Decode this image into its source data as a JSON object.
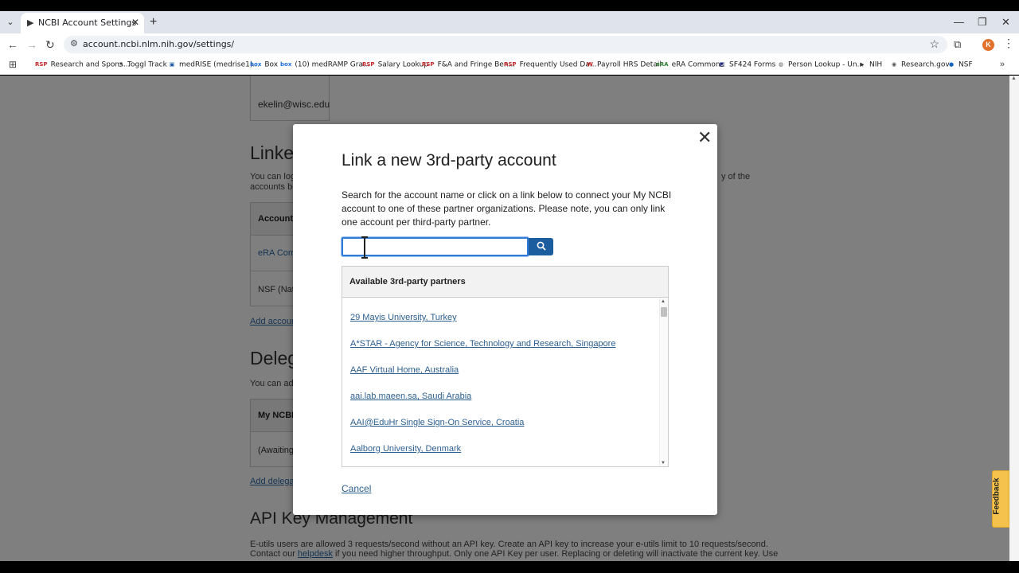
{
  "browser": {
    "tab_title": "NCBI Account Settings",
    "url": "account.ncbi.nlm.nih.gov/settings/",
    "avatar_letter": "K",
    "bookmarks": [
      {
        "label": "Research and Spons...",
        "icon": "RSP",
        "color": "#c62828"
      },
      {
        "label": "Toggl Track",
        "icon": "◔",
        "color": "#333"
      },
      {
        "label": "medRISE (medrise1)...",
        "icon": "▣",
        "color": "#1e5aa8"
      },
      {
        "label": "Box",
        "icon": "box",
        "color": "#1e6fd9"
      },
      {
        "label": "(10) medRAMP Gra...",
        "icon": "box",
        "color": "#1e6fd9"
      },
      {
        "label": "Salary Lookup",
        "icon": "RSP",
        "color": "#c62828"
      },
      {
        "label": "F&A and Fringe Ben...",
        "icon": "RSP",
        "color": "#c62828"
      },
      {
        "label": "Frequently Used Da...",
        "icon": "RSP",
        "color": "#c62828"
      },
      {
        "label": "Payroll HRS Detail",
        "icon": "W",
        "color": "#b71c1c"
      },
      {
        "label": "eRA Commons",
        "icon": "eRA",
        "color": "#2e7d32"
      },
      {
        "label": "SF424 Forms",
        "icon": "◩",
        "color": "#1a237e"
      },
      {
        "label": "Person Lookup - Un...",
        "icon": "◍",
        "color": "#555"
      },
      {
        "label": "NIH",
        "icon": "▶",
        "color": "#333"
      },
      {
        "label": "Research.gov",
        "icon": "◉",
        "color": "#555"
      },
      {
        "label": "NSF",
        "icon": "●",
        "color": "#1565c0"
      }
    ]
  },
  "background_page": {
    "email": "ekelin@wisc.edu",
    "linked_heading": "Linked",
    "linked_text_start": "You can log",
    "linked_text_end": "y of the",
    "linked_text_line2": "accounts be",
    "table_header": "Account",
    "row1": "eRA Comm",
    "row2": "NSF (Natio",
    "add_account_link": "Add accoun",
    "delegates_heading": "Delega",
    "delegates_text": "You can ad",
    "delegates_table_header": "My NCBI",
    "delegates_row": "(Awaiting",
    "add_delegate_link": "Add delega",
    "api_heading": "API Key Management",
    "api_text_line1": "E-utils users are allowed 3 requests/second without an API key. Create an API key to increase your e-utils limit to 10 requests/second.",
    "api_text_line2_a": "Contact our ",
    "api_text_helpdesk": "helpdesk",
    "api_text_line2_b": " if you need higher throughput. Only one API Key per user. Replacing or deleting will inactivate the current key. Use"
  },
  "modal": {
    "title": "Link a new 3rd-party account",
    "description": "Search for the account name or click on a link below to connect your My NCBI account to one of these partner organizations. Please note, you can only link one account per third-party partner.",
    "search_value": "",
    "partners_heading": "Available 3rd-party partners",
    "partners": [
      "29 Mayis University, Turkey",
      "A*STAR - Agency for Science, Technology and Research, Singapore",
      "AAF Virtual Home, Australia",
      "aai.lab.maeen.sa, Saudi Arabia",
      "AAI@EduHr Single Sign-On Service, Croatia",
      "Aalborg University, Denmark"
    ],
    "cancel_label": "Cancel"
  },
  "feedback_label": "Feedback"
}
